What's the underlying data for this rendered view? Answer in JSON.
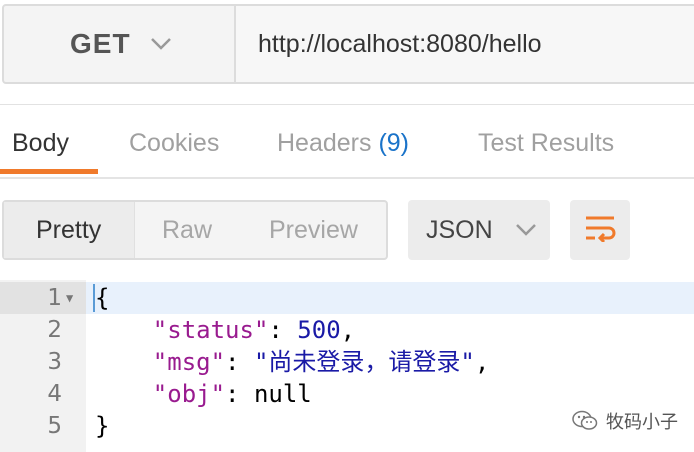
{
  "request": {
    "method": "GET",
    "url": "http://localhost:8080/hello"
  },
  "response_tabs": [
    {
      "label": "Body",
      "active": true
    },
    {
      "label": "Cookies",
      "active": false
    },
    {
      "label": "Headers",
      "count": "(9)",
      "active": false
    },
    {
      "label": "Test Results",
      "active": false
    }
  ],
  "view_modes": [
    {
      "label": "Pretty",
      "active": true
    },
    {
      "label": "Raw",
      "active": false
    },
    {
      "label": "Preview",
      "active": false
    }
  ],
  "format": {
    "selected": "JSON"
  },
  "editor": {
    "lines": [
      {
        "number": "1",
        "text": "{"
      },
      {
        "number": "2",
        "key": "\"status\"",
        "sep": ": ",
        "value": "500",
        "tail": ","
      },
      {
        "number": "3",
        "key": "\"msg\"",
        "sep": ": ",
        "value": "\"尚未登录，请登录\"",
        "tail": ","
      },
      {
        "number": "4",
        "key": "\"obj\"",
        "sep": ": ",
        "value": "null",
        "tail": ""
      },
      {
        "number": "5",
        "text": "}"
      }
    ]
  },
  "watermark": {
    "text": "牧码小子"
  },
  "colors": {
    "accent": "#f07a2b",
    "count_blue": "#1a73c9",
    "json_key": "#991b8f",
    "json_value": "#1a1aa6"
  },
  "icons": {
    "method_dropdown": "chevron-down-icon",
    "format_dropdown": "chevron-down-icon",
    "wrap": "wrap-lines-icon",
    "fold": "fold-triangle-icon",
    "watermark": "wechat-icon"
  }
}
